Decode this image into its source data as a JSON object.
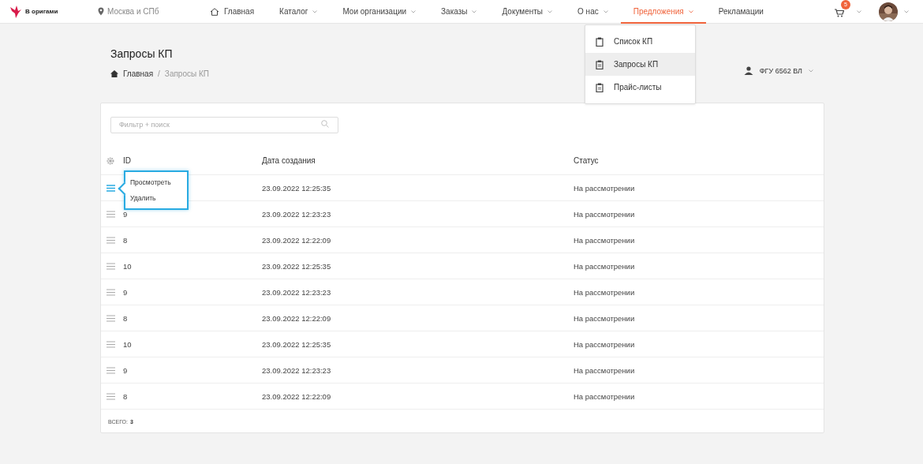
{
  "brand": {
    "name": "В оригами"
  },
  "location": "Москва и СПб",
  "nav": [
    {
      "label": "Главная",
      "kind": "home",
      "dropdown": false,
      "selected": false
    },
    {
      "label": "Каталог",
      "kind": "plain",
      "dropdown": true,
      "selected": false
    },
    {
      "label": "Мои организации",
      "kind": "plain",
      "dropdown": true,
      "selected": false
    },
    {
      "label": "Заказы",
      "kind": "plain",
      "dropdown": true,
      "selected": false
    },
    {
      "label": "Документы",
      "kind": "plain",
      "dropdown": true,
      "selected": false
    },
    {
      "label": "О нас",
      "kind": "plain",
      "dropdown": true,
      "selected": false
    },
    {
      "label": "Предложения",
      "kind": "plain",
      "dropdown": true,
      "selected": true
    },
    {
      "label": "Рекламации",
      "kind": "plain",
      "dropdown": false,
      "selected": false
    }
  ],
  "cart": {
    "badge": "5"
  },
  "submenu": [
    {
      "label": "Список КП",
      "selected": false
    },
    {
      "label": "Запросы КП",
      "selected": true
    },
    {
      "label": "Прайс-листы",
      "selected": false
    }
  ],
  "page": {
    "title": "Запросы КП",
    "breadcrumbs": [
      "Главная",
      "Запросы КП"
    ],
    "breadcrumb_separator": "/"
  },
  "organization": "ФГУ 6562 ВЛ",
  "filter": {
    "placeholder": "Фильтр + поиск"
  },
  "table": {
    "columns": [
      "ID",
      "Дата создания",
      "Статус"
    ],
    "rows": [
      {
        "date": "23.09.2022 12:25:35",
        "status": "На рассмотрении",
        "menu_open": true,
        "menu": [
          "Просмотреть",
          "Удалить"
        ]
      },
      {
        "id": "9",
        "date": "23.09.2022 12:23:23",
        "status": "На рассмотрении",
        "menu_open": false
      },
      {
        "id": "8",
        "date": "23.09.2022 12:22:09",
        "status": "На рассмотрении",
        "menu_open": false
      },
      {
        "id": "10",
        "date": "23.09.2022 12:25:35",
        "status": "На рассмотрении",
        "menu_open": false
      },
      {
        "id": "9",
        "date": "23.09.2022 12:23:23",
        "status": "На рассмотрении",
        "menu_open": false
      },
      {
        "id": "8",
        "date": "23.09.2022 12:22:09",
        "status": "На рассмотрении",
        "menu_open": false
      },
      {
        "id": "10",
        "date": "23.09.2022 12:25:35",
        "status": "На рассмотрении",
        "menu_open": false
      },
      {
        "id": "9",
        "date": "23.09.2022 12:23:23",
        "status": "На рассмотрении",
        "menu_open": false
      },
      {
        "id": "8",
        "date": "23.09.2022 12:22:09",
        "status": "На рассмотрении",
        "menu_open": false
      }
    ]
  },
  "total": {
    "label": "ВСЕГО:",
    "value": "3"
  }
}
